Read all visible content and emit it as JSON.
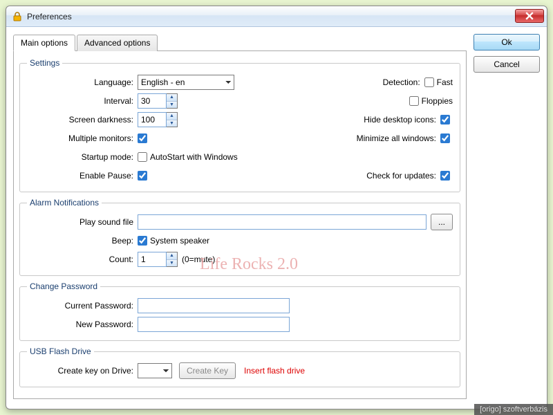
{
  "window": {
    "title": "Preferences"
  },
  "tabs": {
    "main": "Main options",
    "advanced": "Advanced options"
  },
  "groups": {
    "settings": "Settings",
    "alarm": "Alarm Notifications",
    "password": "Change Password",
    "usb": "USB Flash Drive"
  },
  "settings": {
    "language_label": "Language:",
    "language_value": "English - en",
    "interval_label": "Interval:",
    "interval_value": "30",
    "darkness_label": "Screen darkness:",
    "darkness_value": "100",
    "multimon_label": "Multiple monitors:",
    "startup_label": "Startup mode:",
    "startup_text": "AutoStart with Windows",
    "pause_label": "Enable Pause:",
    "detection_label": "Detection:",
    "fast_text": "Fast",
    "floppies_text": "Floppies",
    "hideicons_label": "Hide desktop icons:",
    "minimize_label": "Minimize all windows:",
    "updates_label": "Check for updates:"
  },
  "alarm": {
    "playsound_label": "Play sound file",
    "beep_label": "Beep:",
    "beep_text": "System speaker",
    "count_label": "Count:",
    "count_value": "1",
    "count_hint": "(0=mute)"
  },
  "password": {
    "current_label": "Current Password:",
    "new_label": "New Password:"
  },
  "usb": {
    "createon_label": "Create key on Drive:",
    "createkey_btn": "Create Key",
    "insert_text": "Insert flash drive"
  },
  "buttons": {
    "ok": "Ok",
    "cancel": "Cancel"
  },
  "watermark_text": "Life Rocks 2.0",
  "footer": "[origo] szoftverbázis"
}
